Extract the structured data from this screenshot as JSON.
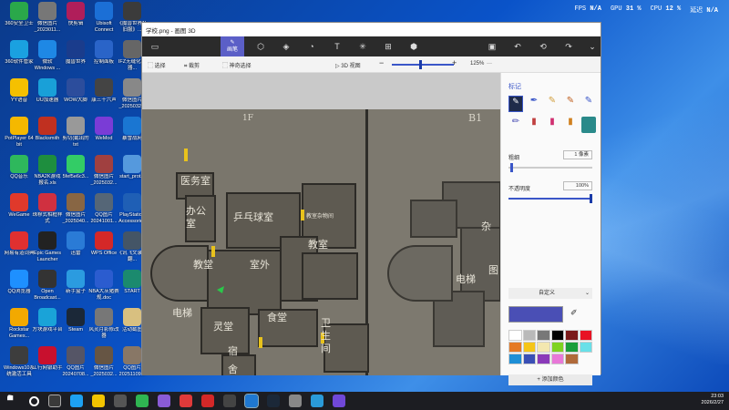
{
  "overlay": {
    "fps_label": "FPS",
    "fps_value": "N/A",
    "gpu_label": "GPU",
    "gpu_value": "31 %",
    "cpu_label": "CPU",
    "cpu_value": "12 %",
    "latency_label": "延迟",
    "latency_value": "N/A"
  },
  "desktop_icons": [
    {
      "label": "360安全卫士",
      "color": "#2aa84a"
    },
    {
      "label": "微信图片_2023011...",
      "color": "#777"
    },
    {
      "label": "快剪辑",
      "color": "#b01e5a"
    },
    {
      "label": "Ubisoft Connect",
      "color": "#1b6fd6"
    },
    {
      "label": "《魔兽世界怀旧服》...",
      "color": "#3b3b3b"
    },
    {
      "label": "360软件管家",
      "color": "#1aa1e0"
    },
    {
      "label": "微软 Windows ...",
      "color": "#1e88e5"
    },
    {
      "label": "魔兽世界",
      "color": "#1a3c8c"
    },
    {
      "label": "控制面板",
      "color": "#2a64c8"
    },
    {
      "label": "IFZ无缝化成器...",
      "color": "#666"
    },
    {
      "label": "YY语音",
      "color": "#f5c000"
    },
    {
      "label": "UU加速器",
      "color": "#19a0d8"
    },
    {
      "label": "WOW大脚",
      "color": "#2c4d9c"
    },
    {
      "label": "康三十六声",
      "color": "#444"
    },
    {
      "label": "微信图片_2025032...",
      "color": "#888"
    },
    {
      "label": "PotPlayer 64 bit",
      "color": "#f5b800"
    },
    {
      "label": "Blacksmith",
      "color": "#c03020"
    },
    {
      "label": "剪切(截出的txt",
      "color": "#999"
    },
    {
      "label": "WeMod",
      "color": "#7a3cd6"
    },
    {
      "label": "暴雪战网",
      "color": "#1a76d2"
    },
    {
      "label": "QQ音乐",
      "color": "#2eb85c"
    },
    {
      "label": "NBA2K游戏报名.xls",
      "color": "#1e8e3e"
    },
    {
      "label": "5fef5e6c3...",
      "color": "#33cc66"
    },
    {
      "label": "微信图片_2025032...",
      "color": "#a04040"
    },
    {
      "label": "start_prot...",
      "color": "#5599dd"
    },
    {
      "label": "WeGame",
      "color": "#e0392b"
    },
    {
      "label": "珠穆式相框样式",
      "color": "#d03040"
    },
    {
      "label": "微信图片_2025040...",
      "color": "#886644"
    },
    {
      "label": "QQ图片20241001...",
      "color": "#556677"
    },
    {
      "label": "PlayStation Accessories",
      "color": "#1f5fb5"
    },
    {
      "label": "网易有道词典",
      "color": "#e03030"
    },
    {
      "label": "Epic Games Launcher",
      "color": "#222"
    },
    {
      "label": "迅雷",
      "color": "#2a7bd6"
    },
    {
      "label": "WPS Office",
      "color": "#d42828"
    },
    {
      "label": "《讯飞文录》翻...",
      "color": "#445566"
    },
    {
      "label": "QQ浏览器",
      "color": "#1e90ff"
    },
    {
      "label": "Open Broadcast...",
      "color": "#333"
    },
    {
      "label": "新手盒子",
      "color": "#2b9be0"
    },
    {
      "label": "NBA大灰猪赛规.doc",
      "color": "#2b5ccf"
    },
    {
      "label": "START",
      "color": "#1b8a6e"
    },
    {
      "label": "Rockstar Games...",
      "color": "#f2a900"
    },
    {
      "label": "方块游戏平台",
      "color": "#1aa3d8"
    },
    {
      "label": "Steam",
      "color": "#1b2838"
    },
    {
      "label": "风灵月影修改器",
      "color": "#777"
    },
    {
      "label": "活动截图",
      "color": "#d8c080"
    },
    {
      "label": "Windows10系统激活工具",
      "color": "#3d3d3d"
    },
    {
      "label": "工行网银助手",
      "color": "#c8102e"
    },
    {
      "label": "QQ图片20240708...",
      "color": "#556"
    },
    {
      "label": "微信图片_2025032...",
      "color": "#665544"
    },
    {
      "label": "QQ图片20251109...",
      "color": "#887766"
    }
  ],
  "window": {
    "title": "学校.png - 画图 3D",
    "active_tool_label": "画笔",
    "select_label": "选择",
    "crop_label": "裁剪",
    "magic_select_label": "神奇选择",
    "view3d_label": "3D 视图",
    "zoom_value": "125%"
  },
  "map": {
    "floor_1f": "1F",
    "floor_b1": "B1",
    "rooms": [
      "医务室",
      "办公室",
      "乒乓球室",
      "教室杂物间",
      "教室",
      "教堂",
      "室外",
      "电梯",
      "灵堂",
      "食堂",
      "卫生间",
      "宿舍",
      "杂",
      "图",
      "电梯"
    ]
  },
  "panel": {
    "header": "标记",
    "thickness_label": "粗细",
    "thickness_value": "1 像素",
    "opacity_label": "不透明度",
    "opacity_value": "100%",
    "color_mode": "自定义",
    "add_color_label": "添加颜色",
    "current_color": "#4a4fb5",
    "palette": [
      "#ffffff",
      "#b9b9b9",
      "#787878",
      "#000000",
      "#7a1a1a",
      "#e81224",
      "#e57a24",
      "#f5c518",
      "#f3e7b0",
      "#7ed321",
      "#1a9e3a",
      "#68e0e8",
      "#1e8fd6",
      "#3a4fb5",
      "#8a3ab9",
      "#e878d8",
      "#b06a3a"
    ]
  },
  "clock": {
    "time": "23:03",
    "date": "2026/2/27"
  }
}
